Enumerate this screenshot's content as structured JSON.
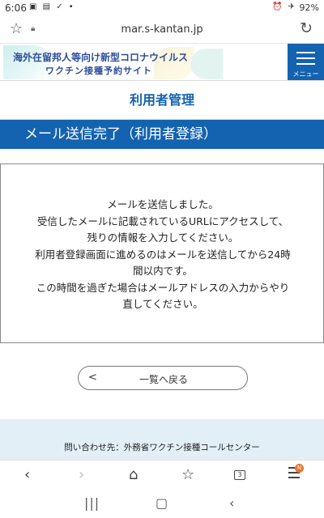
{
  "status_bar": {
    "time": "6:06",
    "left_icons": "▣ ▤ ✓ •",
    "right_icons": "⏰ ✈",
    "battery": "92%"
  },
  "browser": {
    "url": "mar.s-kantan.jp"
  },
  "site_header": {
    "title_line1": "海外在留邦人等向け新型コロナウイルス",
    "title_line2": "ワクチン接種予約サイト",
    "menu_label": "メニュー"
  },
  "page": {
    "section_title": "利用者管理",
    "banner": "メール送信完了（利用者登録）",
    "message_lines": [
      "メールを送信しました。",
      "受信したメールに記載されているURLにアクセスして、",
      "残りの情報を入力してください。",
      "利用者登録画面に進めるのはメールを送信してから24時",
      "間以内です。",
      "この時間を過ぎた場合はメールアドレスの入力からやり",
      "直してください。"
    ],
    "back_label": "一覧へ戻る",
    "back_chevron": "<"
  },
  "footer": {
    "contact": "問い合わせ先：外務省ワクチン接種コールセンター"
  },
  "nav": {
    "tab_count": "3",
    "badge": "N"
  },
  "colors": {
    "brand_blue": "#1463b0",
    "footer_bg": "#e3eff6"
  }
}
